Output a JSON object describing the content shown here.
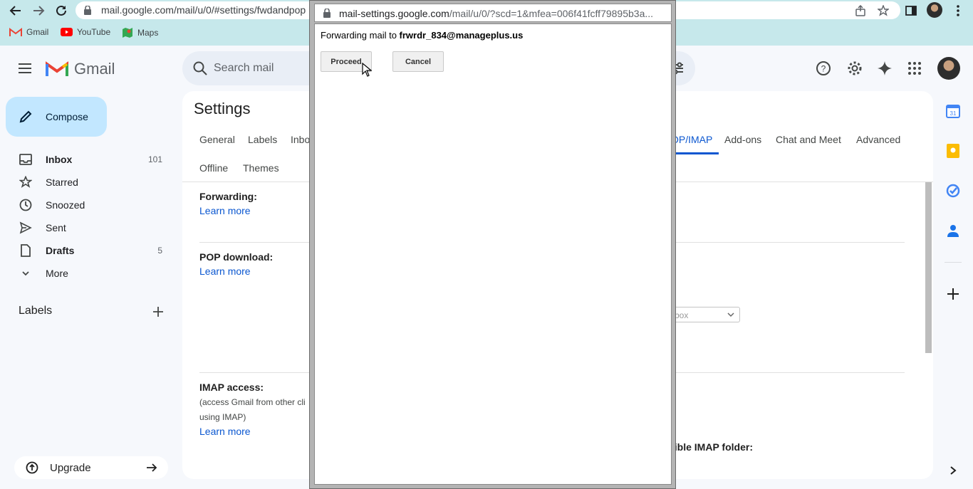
{
  "browser": {
    "url": "mail.google.com/mail/u/0/#settings/fwdandpop",
    "bookmarks": [
      {
        "label": "Gmail",
        "icon": "gmail-icon"
      },
      {
        "label": "YouTube",
        "icon": "youtube-icon"
      },
      {
        "label": "Maps",
        "icon": "maps-icon"
      }
    ]
  },
  "gmail": {
    "logo_text": "Gmail",
    "search_placeholder": "Search mail"
  },
  "sidebar": {
    "compose_label": "Compose",
    "items": [
      {
        "label": "Inbox",
        "count": "101",
        "icon": "inbox-icon",
        "bold": true
      },
      {
        "label": "Starred",
        "count": "",
        "icon": "star-icon"
      },
      {
        "label": "Snoozed",
        "count": "",
        "icon": "clock-icon"
      },
      {
        "label": "Sent",
        "count": "",
        "icon": "send-icon"
      },
      {
        "label": "Drafts",
        "count": "5",
        "icon": "draft-icon",
        "bold": true
      },
      {
        "label": "More",
        "count": "",
        "icon": "chevron-down-icon"
      }
    ],
    "labels_heading": "Labels",
    "upgrade_label": "Upgrade"
  },
  "settings": {
    "title": "Settings",
    "tabs": [
      "General",
      "Labels",
      "Inbo",
      "OP/IMAP",
      "Add-ons",
      "Chat and Meet",
      "Advanced",
      "Offline",
      "Themes"
    ],
    "active_tab": "OP/IMAP",
    "sections": {
      "forwarding": {
        "title": "Forwarding:",
        "learn_more": "Learn more"
      },
      "pop": {
        "title": "POP download:",
        "learn_more": "Learn more"
      },
      "imap": {
        "title": "IMAP access:",
        "desc_line1": "(access Gmail from other cli",
        "desc_line2": "using IMAP)",
        "learn_more": "Learn more"
      }
    },
    "select_value": "box",
    "imap_folder_label": "sible IMAP folder:"
  },
  "popup": {
    "url_host": "mail-settings.google.com",
    "url_path": "/mail/u/0/?scd=1&mfea=006f41fcff79895b3a...",
    "message_prefix": "Forwarding mail to ",
    "address": "frwrdr_834@manageplus.us",
    "proceed_label": "Proceed",
    "cancel_label": "Cancel"
  },
  "colors": {
    "accent": "#0b57d0",
    "compose_bg": "#c2e7ff",
    "chrome_bg": "#c6e8eb"
  }
}
